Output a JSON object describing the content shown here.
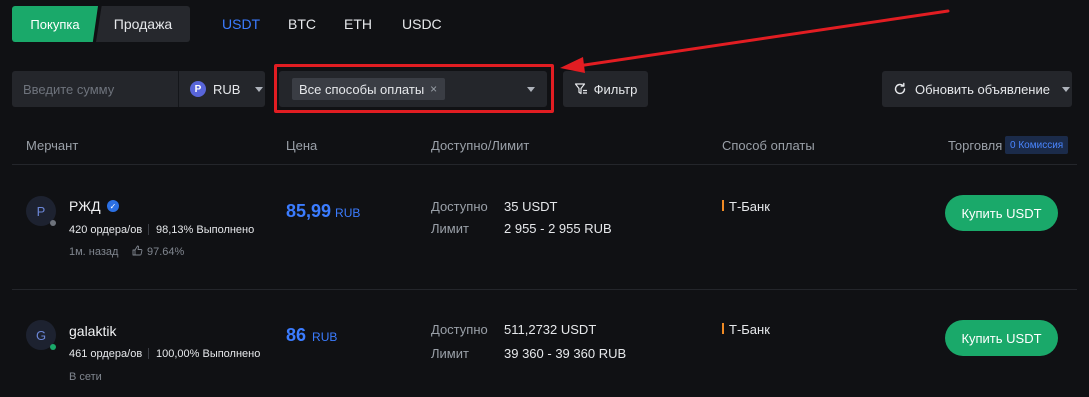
{
  "tabs": {
    "buy": "Покупка",
    "sell": "Продажа"
  },
  "coins": [
    "USDT",
    "BTC",
    "ETH",
    "USDC"
  ],
  "filters": {
    "amount_placeholder": "Введите сумму",
    "currency": "RUB",
    "currency_icon": "P",
    "payment_chip": "Все способы оплаты",
    "filter_label": "Фильтр",
    "refresh_label": "Обновить объявление"
  },
  "headers": {
    "merchant": "Мерчант",
    "price": "Цена",
    "available": "Доступно/Лимит",
    "payment": "Способ оплаты",
    "trade": "Торговля",
    "fee_badge": "0 Комиссия"
  },
  "rows": [
    {
      "avatar": "P",
      "name": "РЖД",
      "verified": true,
      "orders": "420 ордера/ов",
      "completion": "98,13% Выполнено",
      "last_seen": "1м. назад",
      "rating": "97.64%",
      "price": "85,99",
      "currency": "RUB",
      "available_label": "Доступно",
      "available": "35 USDT",
      "limit_label": "Лимит",
      "limit": "2 955 - 2 955 RUB",
      "payment": "Т-Банк",
      "button": "Купить USDT"
    },
    {
      "avatar": "G",
      "name": "galaktik",
      "verified": false,
      "orders": "461 ордера/ов",
      "completion": "100,00% Выполнено",
      "status": "В сети",
      "price": "86",
      "currency": "RUB",
      "available_label": "Доступно",
      "available": "511,2732 USDT",
      "limit_label": "Лимит",
      "limit": "39 360 - 39 360 RUB",
      "payment": "Т-Банк",
      "button": "Купить USDT"
    }
  ],
  "colors": {
    "accent_green": "#1aa96a",
    "accent_blue": "#3b7cff",
    "annotation_red": "#e21d22",
    "payment_bar": "#f08a24",
    "online_dot": "#1aa96a",
    "offline_dot": "#6e737c"
  }
}
